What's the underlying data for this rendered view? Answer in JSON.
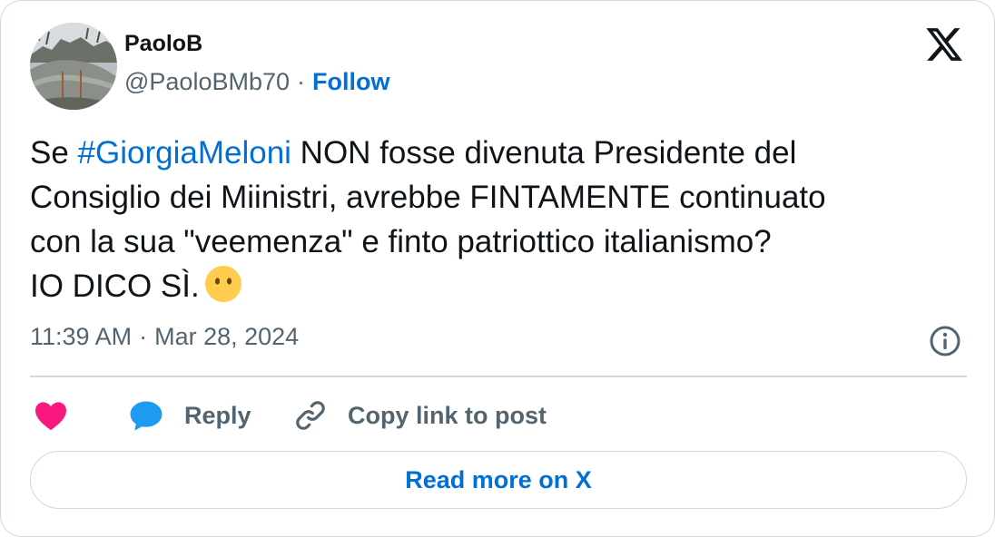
{
  "author": {
    "name": "PaoloB",
    "handle": "@PaoloBMb70",
    "separator": "·",
    "follow_label": "Follow"
  },
  "tweet": {
    "text_before": "Se ",
    "hashtag": "#GiorgiaMeloni",
    "text_line1_rest": " NON fosse divenuta Presidente del",
    "text_line2": "Consiglio dei Miinistri, avrebbe FINTAMENTE continuato",
    "text_line3": "con la sua \"veemenza\" e finto patriottico italianismo?",
    "text_line4": "IO DICO SÌ.",
    "emoji": "face-without-mouth"
  },
  "meta": {
    "time": "11:39 AM",
    "separator": "·",
    "date": "Mar 28, 2024"
  },
  "actions": {
    "like_icon": "heart-icon",
    "reply_label": "Reply",
    "copy_label": "Copy link to post"
  },
  "cta": {
    "read_more_label": "Read more on X"
  },
  "colors": {
    "link": "#006fd6",
    "secondary_text": "#536471",
    "heart": "#f91880",
    "reply_bubble": "#1d9bf0",
    "border": "#cfd9de"
  }
}
